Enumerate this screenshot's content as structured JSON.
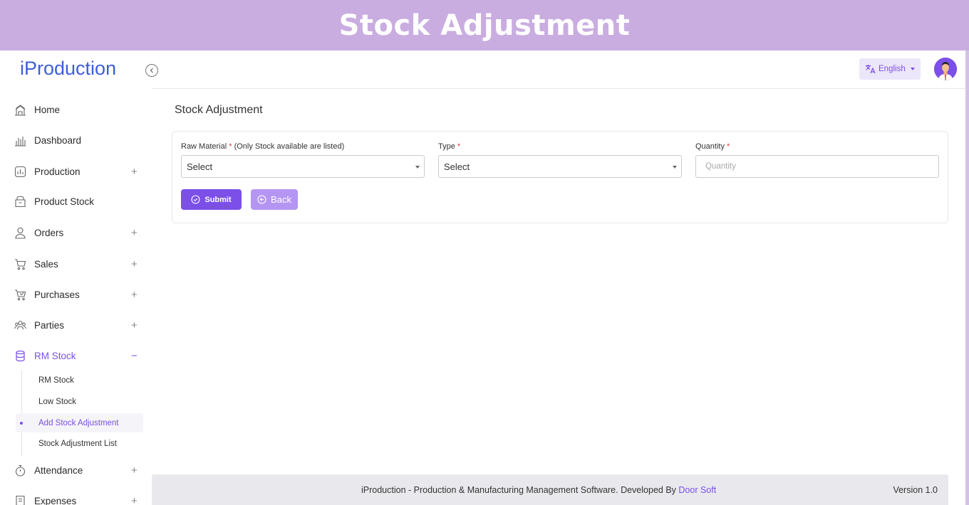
{
  "banner": {
    "title": "Stock Adjustment"
  },
  "app": {
    "logo": "iProduction"
  },
  "sidebar": {
    "items": [
      {
        "label": "Home",
        "icon": "home-icon",
        "expand": ""
      },
      {
        "label": "Dashboard",
        "icon": "bar-chart-icon",
        "expand": ""
      },
      {
        "label": "Production",
        "icon": "production-chart-icon",
        "expand": "+"
      },
      {
        "label": "Product Stock",
        "icon": "box-icon",
        "expand": ""
      },
      {
        "label": "Orders",
        "icon": "user-icon",
        "expand": "+"
      },
      {
        "label": "Sales",
        "icon": "cart-icon",
        "expand": "+"
      },
      {
        "label": "Purchases",
        "icon": "cart-arrow-icon",
        "expand": "+"
      },
      {
        "label": "Parties",
        "icon": "users-icon",
        "expand": "+"
      },
      {
        "label": "RM Stock",
        "icon": "database-icon",
        "expand": "−"
      },
      {
        "label": "Attendance",
        "icon": "stopwatch-icon",
        "expand": "+"
      },
      {
        "label": "Expenses",
        "icon": "receipt-icon",
        "expand": "+"
      }
    ],
    "submenu": [
      {
        "label": "RM Stock"
      },
      {
        "label": "Low Stock"
      },
      {
        "label": "Add Stock Adjustment"
      },
      {
        "label": "Stock Adjustment List"
      }
    ]
  },
  "topbar": {
    "language": "English"
  },
  "main": {
    "page_title": "Stock Adjustment",
    "form": {
      "raw_material_label": "Raw Material",
      "raw_material_note": " (Only Stock available are listed)",
      "raw_material_value": "Select",
      "type_label": "Type",
      "type_value": "Select",
      "quantity_label": "Quantity",
      "quantity_placeholder": "Quantity",
      "required_mark": "*",
      "submit_label": "Submit",
      "back_label": "Back"
    }
  },
  "footer": {
    "text": "iProduction - Production & Manufacturing Management Software. Developed By ",
    "link": "Door Soft",
    "version": "Version 1.0"
  },
  "colors": {
    "accent": "#7b4fe8",
    "banner": "#c9ade0",
    "logo": "#3d5fd9"
  }
}
